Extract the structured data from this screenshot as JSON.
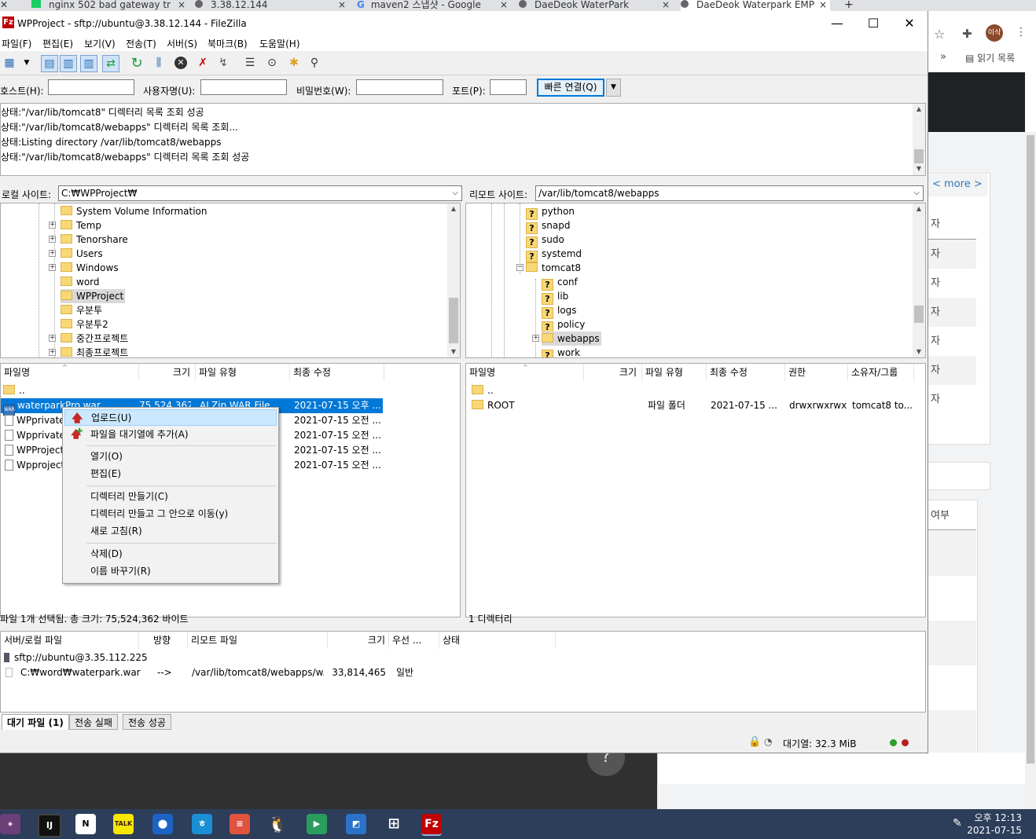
{
  "browser": {
    "tabs": [
      {
        "title": "nginx 502 bad gateway tr",
        "close": "×"
      },
      {
        "title": "3.38.12.144",
        "close": "×"
      },
      {
        "title": "maven2 스냅샷 - Google",
        "close": "×"
      },
      {
        "title": "DaeDeok WaterPark",
        "close": "×"
      },
      {
        "title": "DaeDeok Waterpark EMP",
        "close": "×"
      }
    ],
    "new_tab": "+",
    "reading_list": "읽기 목록",
    "more_chevron": "»",
    "more_link": "< more >",
    "avatar_text": "이삭",
    "table_col_suffix": [
      "자",
      "자",
      "자",
      "자",
      "자",
      "자",
      "자"
    ],
    "table2_header": "여부",
    "help_fab": "?"
  },
  "window": {
    "title": "WPProject - sftp://ubuntu@3.38.12.144 - FileZilla",
    "minimize": "—",
    "maximize": "☐",
    "close": "✕"
  },
  "menu": [
    "파일(F)",
    "편집(E)",
    "보기(V)",
    "전송(T)",
    "서버(S)",
    "북마크(B)",
    "도움말(H)"
  ],
  "quickconnect": {
    "host_label": "호스트(H):",
    "host_value": "",
    "user_label": "사용자명(U):",
    "user_value": "",
    "pass_label": "비밀번호(W):",
    "pass_value": "",
    "port_label": "포트(P):",
    "port_value": "",
    "connect_button": "빠른 연결(Q)",
    "dropdown_arrow": "▼"
  },
  "log": [
    "상태:\"/var/lib/tomcat8\" 디렉터리 목록 조회 성공",
    "상태:\"/var/lib/tomcat8/webapps\" 디렉터리 목록 조회...",
    "상태:Listing directory /var/lib/tomcat8/webapps",
    "상태:\"/var/lib/tomcat8/webapps\" 디렉터리 목록 조회 성공"
  ],
  "local": {
    "site_label": "로컬 사이트:",
    "path": "C:₩WPProject₩",
    "tree": [
      {
        "label": "System Volume Information",
        "expandable": false
      },
      {
        "label": "Temp",
        "expandable": true
      },
      {
        "label": "Tenorshare",
        "expandable": true
      },
      {
        "label": "Users",
        "expandable": true
      },
      {
        "label": "Windows",
        "expandable": true
      },
      {
        "label": "word",
        "expandable": false
      },
      {
        "label": "WPProject",
        "expandable": false
      },
      {
        "label": "우분투",
        "expandable": false
      },
      {
        "label": "우분투2",
        "expandable": false
      },
      {
        "label": "중간프로젝트",
        "expandable": true
      },
      {
        "label": "최종프로젝트",
        "expandable": true
      }
    ],
    "columns": [
      "파일명",
      "크기",
      "파일 유형",
      "최종 수정"
    ],
    "files": [
      {
        "name": "..",
        "size": "",
        "type": "",
        "modified": ""
      },
      {
        "name": "waterparkPro.war",
        "size": "75,524,362",
        "type": "ALZip WAR File",
        "modified": "2021-07-15 오후 ..."
      },
      {
        "name": "WPprivate.p",
        "size": "",
        "type": "",
        "modified": "2021-07-15 오전 ..."
      },
      {
        "name": "Wpprivate2",
        "size": "",
        "type": "",
        "modified": "2021-07-15 오전 ..."
      },
      {
        "name": "WPProject.p",
        "size": "",
        "type": "",
        "modified": "2021-07-15 오전 ..."
      },
      {
        "name": "Wpproject2",
        "size": "",
        "type": "",
        "modified": "2021-07-15 오전 ..."
      }
    ],
    "status": "파일 1개 선택됨. 총 크기: 75,524,362 바이트"
  },
  "remote": {
    "site_label": "리모트 사이트:",
    "path": "/var/lib/tomcat8/webapps",
    "tree": [
      {
        "label": "python",
        "unknown": true
      },
      {
        "label": "snapd",
        "unknown": true
      },
      {
        "label": "sudo",
        "unknown": true
      },
      {
        "label": "systemd",
        "unknown": true
      },
      {
        "label": "tomcat8",
        "unknown": false
      },
      {
        "label": "conf",
        "unknown": true
      },
      {
        "label": "lib",
        "unknown": true
      },
      {
        "label": "logs",
        "unknown": true
      },
      {
        "label": "policy",
        "unknown": true
      },
      {
        "label": "webapps",
        "unknown": false
      },
      {
        "label": "work",
        "unknown": true
      }
    ],
    "columns": [
      "파일명",
      "크기",
      "파일 유형",
      "최종 수정",
      "권한",
      "소유자/그룹"
    ],
    "files": [
      {
        "name": "..",
        "size": "",
        "type": "",
        "modified": "",
        "perm": "",
        "owner": ""
      },
      {
        "name": "ROOT",
        "size": "",
        "type": "파일 폴더",
        "modified": "2021-07-15 ...",
        "perm": "drwxrwxrwx",
        "owner": "tomcat8 to..."
      }
    ],
    "status": "1 디렉터리"
  },
  "context_menu": [
    {
      "label": "업로드(U)",
      "icon": "upload-arrow-icon"
    },
    {
      "label": "파일을 대기열에 추가(A)",
      "icon": "add-to-queue-icon"
    },
    {
      "label": "열기(O)"
    },
    {
      "label": "편집(E)"
    },
    {
      "label": "디렉터리 만들기(C)"
    },
    {
      "label": "디렉터리 만들고 그 안으로 이동(y)"
    },
    {
      "label": "새로 고침(R)"
    },
    {
      "label": "삭제(D)"
    },
    {
      "label": "이름 바꾸기(R)"
    }
  ],
  "queue": {
    "columns": [
      "서버/로컬 파일",
      "방향",
      "리모트 파일",
      "크기",
      "우선 ...",
      "상태"
    ],
    "server": "sftp://ubuntu@3.35.112.225",
    "item": {
      "local": "C:₩word₩waterpark.war",
      "direction": "-->",
      "remote": "/var/lib/tomcat8/webapps/w...",
      "size": "33,814,465",
      "priority": "일반",
      "status": ""
    },
    "tabs": [
      "대기 파일 (1)",
      "전송 실패",
      "전송 성공"
    ]
  },
  "statusbar": {
    "queue_label": "대기열: 32.3 MiB"
  },
  "taskbar": {
    "time": "오후 12:13",
    "date": "2021-07-15",
    "apps": [
      "talk-app",
      "maps-app",
      "hangul-app",
      "presenter-app",
      "tux-app",
      "media-app",
      "photos-app",
      "network-app",
      "filezilla-app"
    ]
  },
  "colors": {
    "selection": "#0078d7",
    "menu_highlight": "#cce8ff",
    "folder": "#f8d775",
    "taskbar": "#2c3e5a"
  }
}
